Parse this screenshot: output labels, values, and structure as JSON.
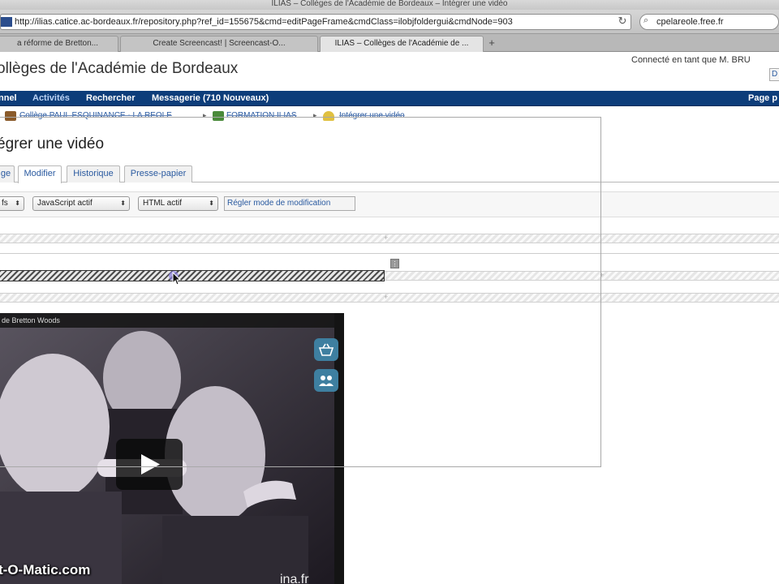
{
  "browser": {
    "window_title": "ILIAS – Collèges de l'Académie de Bordeaux – Intégrer une vidéo",
    "url": "http://ilias.catice.ac-bordeaux.fr/repository.php?ref_id=155675&cmd=editPageFrame&cmdClass=ilobjfoldergui&cmdNode=903",
    "search_query": "cpelareole.free.fr",
    "tabs": [
      {
        "label": "a réforme de Bretton..."
      },
      {
        "label": "Create Screencast! | Screencast-O..."
      },
      {
        "label": "ILIAS – Collèges de l'Académie de ..."
      }
    ],
    "new_tab_label": "+"
  },
  "header": {
    "site_title": "ollèges de l'Académie de Bordeaux",
    "user_info": "Connecté en tant que M. BRU",
    "user_link": "D"
  },
  "mainnav": {
    "items": [
      {
        "label": "nnel"
      },
      {
        "label": "Activités"
      },
      {
        "label": "Rechercher"
      },
      {
        "label": "Messagerie (710 Nouveaux)"
      }
    ],
    "right_link": "Page p"
  },
  "breadcrumb": {
    "items": [
      {
        "label": "Collège PAUL ESQUINANCE - LA REOLE"
      },
      {
        "label": "FORMATION ILIAS"
      },
      {
        "label": "Intégrer une vidéo"
      }
    ],
    "separator": "▸"
  },
  "page": {
    "heading": "égrer une vidéo"
  },
  "subtabs": [
    {
      "label": "ge"
    },
    {
      "label": "Modifier"
    },
    {
      "label": "Historique"
    },
    {
      "label": "Presse-papier"
    }
  ],
  "controls": {
    "select1": "fs",
    "select2": "JavaScript actif",
    "select3": "HTML actif",
    "mode_button": "Régler mode de modification"
  },
  "editor": {
    "plus_marker": "+",
    "drag_handle": "⋮"
  },
  "video": {
    "title": "de Bretton Woods",
    "watermark": "t-O-Matic.com",
    "source_mark": "ina.fr",
    "buttons": {
      "basket_icon": "basket-icon",
      "share_icon": "share-icon"
    }
  },
  "colors": {
    "nav_bg": "#0d3d7a",
    "link": "#2a5aa0",
    "video_button": "#3e7fa0"
  }
}
